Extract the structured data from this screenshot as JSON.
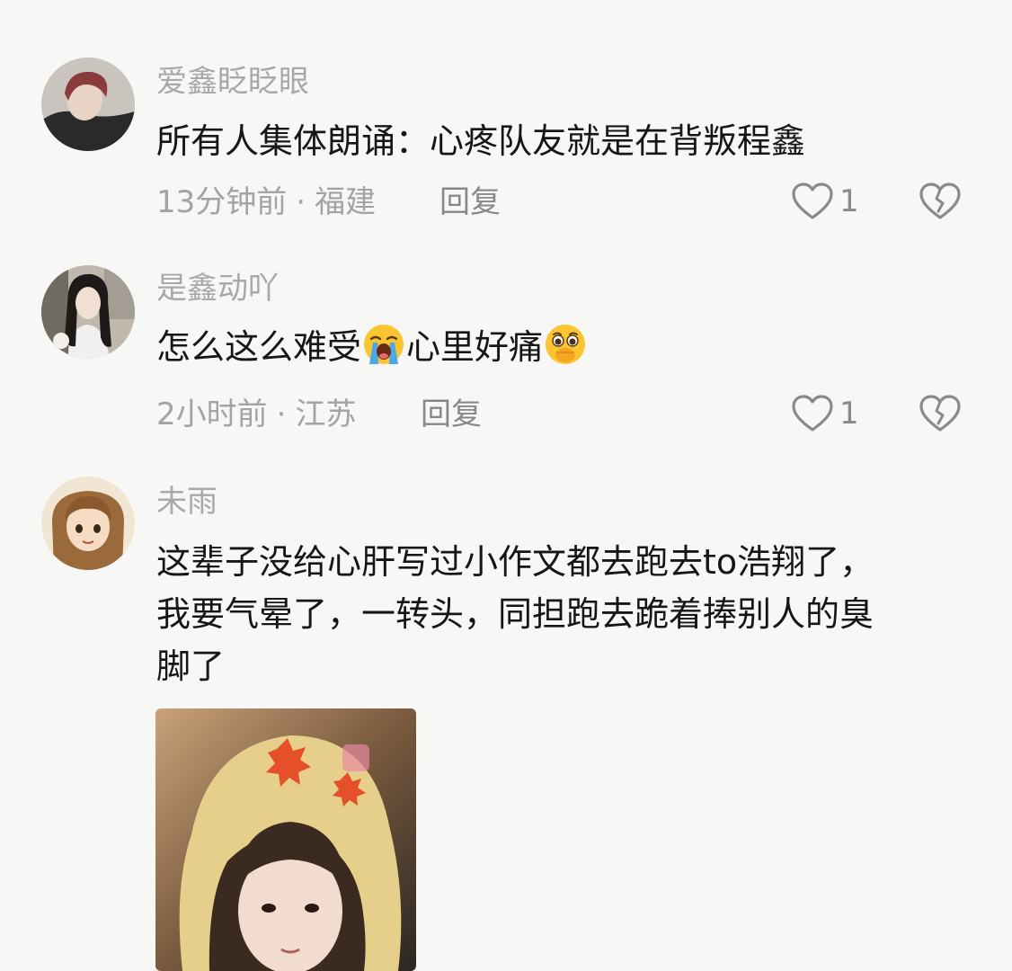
{
  "comments": [
    {
      "username": "爱鑫眨眨眼",
      "text": "所有人集体朗诵：心疼队友就是在背叛程鑫",
      "time": "13分钟前",
      "location": "福建",
      "reply_label": "回复",
      "likes": "1"
    },
    {
      "username": "是鑫动吖",
      "text_part1": "怎么这么难受",
      "emoji1": "loudly-crying-face",
      "text_part2": "心里好痛",
      "emoji2": "face-holding-back-tears",
      "time": "2小时前",
      "location": "江苏",
      "reply_label": "回复",
      "likes": "1"
    },
    {
      "username": "未雨",
      "text_lines": [
        "这辈子没给心肝写过小作文都去跑去to浩翔了，",
        "我要气晕了，一转头，同担跑去跪着捧别人的臭",
        "脚了"
      ]
    }
  ],
  "meta_separator": "·",
  "icons": {
    "like": "heart-outline-icon",
    "dislike": "broken-heart-icon"
  },
  "colors": {
    "background": "#f7f7f5",
    "username": "#a8a8a8",
    "meta": "#a3a3a3",
    "text": "#161616",
    "icon": "#8a8a8a"
  }
}
